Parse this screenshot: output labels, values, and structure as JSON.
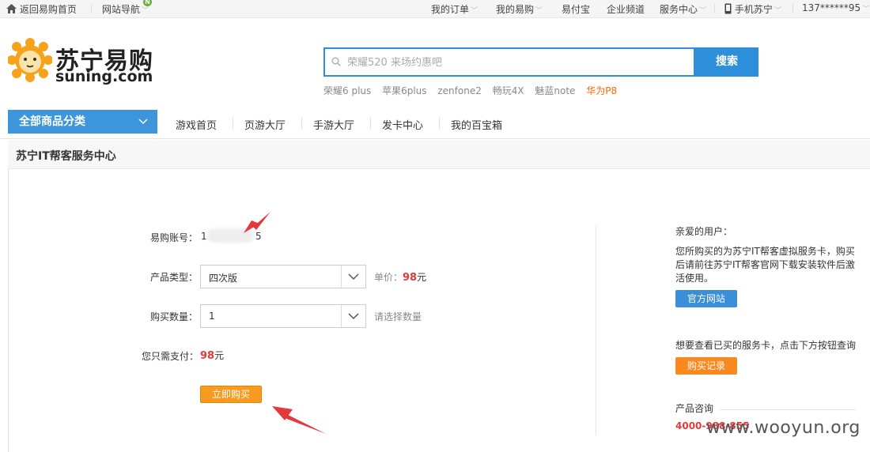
{
  "topbar": {
    "home": "返回易购首页",
    "sitenav": "网站导航",
    "sitenav_badge": "N",
    "my_orders": "我的订单",
    "my_yigou": "我的易购",
    "yifubao": "易付宝",
    "enterprise": "企业频道",
    "service_center": "服务中心",
    "mobile": "手机苏宁",
    "user": "137******95"
  },
  "logo": {
    "cn": "苏宁易购",
    "en": "suning.com"
  },
  "search": {
    "placeholder": "荣耀520 来场约惠吧",
    "button": "搜索",
    "hotwords": [
      "荣耀6 plus",
      "苹果6plus",
      "zenfone2",
      "畅玩4X",
      "魅蓝note"
    ],
    "hotword_highlight": "华为P8"
  },
  "nav": {
    "all_categories": "全部商品分类",
    "items": [
      "游戏首页",
      "页游大厅",
      "手游大厅",
      "发卡中心",
      "我的百宝箱"
    ]
  },
  "panel": {
    "title": "苏宁IT帮客服务中心"
  },
  "form": {
    "account_label": "易购账号：",
    "account_value_start": "1",
    "account_value_end": "5",
    "product_type_label": "产品类型：",
    "product_type_value": "四次版",
    "unit_price_label": "单价：",
    "unit_price_value": "98",
    "unit_price_unit": "元",
    "quantity_label": "购买数量：",
    "quantity_value": "1",
    "quantity_hint": "请选择数量",
    "pay_label": "您只需支付：",
    "pay_value": "98",
    "pay_unit": "元",
    "buy_button": "立即购买"
  },
  "sidebar": {
    "greeting": "亲爱的用户：",
    "desc_line1": "您所购买的为苏宁IT帮客虚拟服务卡，购买",
    "desc_line2": "后请前往苏宁IT帮客官网下载安装软件后激",
    "desc_line3": "活使用。",
    "official_btn": "官方网站",
    "query_text": "想要查看已买的服务卡，点击下方按钮查询",
    "records_btn": "购买记录",
    "consult_label": "产品咨询",
    "phone": "4000-988-855"
  },
  "watermark": "www.wooyun.org",
  "colors": {
    "accent_blue": "#2d8fd9",
    "orange": "#f79a1f",
    "price_red": "#e4393c",
    "hot_orange": "#ff6600"
  }
}
